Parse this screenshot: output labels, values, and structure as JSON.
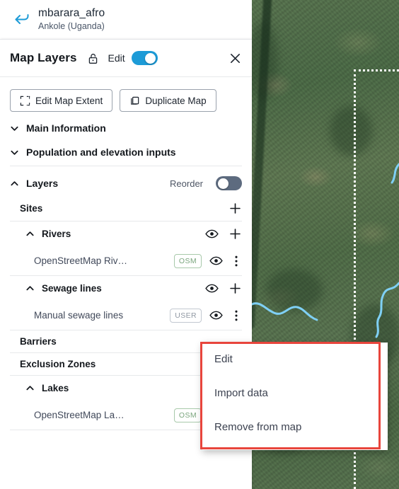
{
  "header": {
    "back_icon": "back-arrow-icon",
    "project_title": "mbarara_afro",
    "project_subtitle": "Ankole (Uganda)"
  },
  "panel": {
    "title": "Map Layers",
    "lock_icon": "unlock-icon",
    "edit_label": "Edit",
    "edit_toggle_on": true,
    "close_icon": "close-icon",
    "accent_color": "#1d9bd7"
  },
  "actions": [
    {
      "label": "Edit Map Extent",
      "icon": "map-extent-icon"
    },
    {
      "label": "Duplicate Map",
      "icon": "duplicate-icon"
    }
  ],
  "sections": [
    {
      "label": "Main Information",
      "expanded": false,
      "caret": "chevron-down-icon"
    },
    {
      "label": "Population and elevation inputs",
      "expanded": false,
      "caret": "chevron-down-icon"
    }
  ],
  "layers_section": {
    "label": "Layers",
    "caret": "chevron-up-icon",
    "reorder_label": "Reorder",
    "reorder_toggle_on": false
  },
  "layer_groups": [
    {
      "name": "Sites",
      "caret": null,
      "actions": [
        "add-icon"
      ],
      "children": []
    },
    {
      "name": "Rivers",
      "caret": "chevron-up-icon",
      "actions": [
        "eye-icon",
        "add-icon"
      ],
      "children": [
        {
          "name": "OpenStreetMap Riv…",
          "badge": "OSM",
          "badge_kind": "osm",
          "actions": [
            "eye-icon",
            "more-vertical-icon"
          ]
        }
      ]
    },
    {
      "name": "Sewage lines",
      "caret": "chevron-up-icon",
      "actions": [
        "eye-icon",
        "add-icon"
      ],
      "children": [
        {
          "name": "Manual sewage lines",
          "badge": "USER",
          "badge_kind": "user",
          "actions": [
            "eye-icon",
            "more-vertical-icon"
          ]
        }
      ]
    },
    {
      "name": "Barriers",
      "caret": null,
      "actions": [],
      "children": []
    },
    {
      "name": "Exclusion Zones",
      "caret": null,
      "actions": [],
      "children": []
    },
    {
      "name": "Lakes",
      "caret": "chevron-up-icon",
      "actions": [
        "eye-icon"
      ],
      "children": [
        {
          "name": "OpenStreetMap La…",
          "badge": "OSM",
          "badge_kind": "osm",
          "actions": [
            "eye-icon"
          ]
        }
      ]
    }
  ],
  "context_menu": {
    "highlight_color": "#e8453c",
    "items": [
      {
        "label": "Edit"
      },
      {
        "label": "Import data"
      },
      {
        "label": "Remove from map"
      }
    ]
  },
  "map": {
    "basemap": "satellite-imagery",
    "boundary_style": "white-dotted"
  }
}
